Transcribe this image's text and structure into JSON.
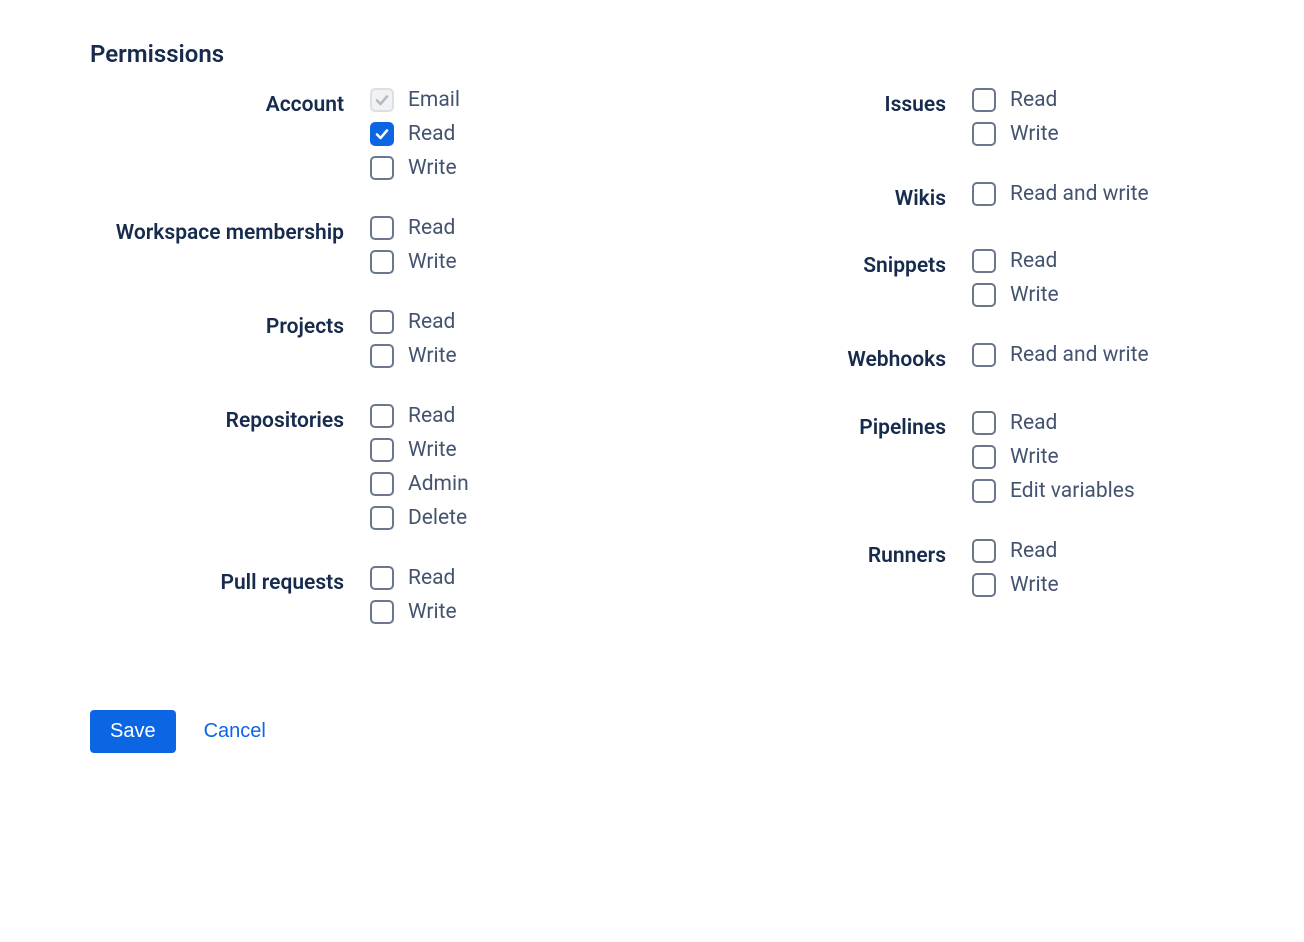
{
  "heading": "Permissions",
  "columns": [
    [
      {
        "label": "Account",
        "options": [
          {
            "label": "Email",
            "state": "disabled"
          },
          {
            "label": "Read",
            "state": "checked"
          },
          {
            "label": "Write",
            "state": "unchecked"
          }
        ]
      },
      {
        "label": "Workspace membership",
        "options": [
          {
            "label": "Read",
            "state": "unchecked"
          },
          {
            "label": "Write",
            "state": "unchecked"
          }
        ]
      },
      {
        "label": "Projects",
        "options": [
          {
            "label": "Read",
            "state": "unchecked"
          },
          {
            "label": "Write",
            "state": "unchecked"
          }
        ]
      },
      {
        "label": "Repositories",
        "options": [
          {
            "label": "Read",
            "state": "unchecked"
          },
          {
            "label": "Write",
            "state": "unchecked"
          },
          {
            "label": "Admin",
            "state": "unchecked"
          },
          {
            "label": "Delete",
            "state": "unchecked"
          }
        ]
      },
      {
        "label": "Pull requests",
        "options": [
          {
            "label": "Read",
            "state": "unchecked"
          },
          {
            "label": "Write",
            "state": "unchecked"
          }
        ]
      }
    ],
    [
      {
        "label": "Issues",
        "options": [
          {
            "label": "Read",
            "state": "unchecked"
          },
          {
            "label": "Write",
            "state": "unchecked"
          }
        ]
      },
      {
        "label": "Wikis",
        "options": [
          {
            "label": "Read and write",
            "state": "unchecked"
          }
        ]
      },
      {
        "label": "Snippets",
        "options": [
          {
            "label": "Read",
            "state": "unchecked"
          },
          {
            "label": "Write",
            "state": "unchecked"
          }
        ]
      },
      {
        "label": "Webhooks",
        "options": [
          {
            "label": "Read and write",
            "state": "unchecked"
          }
        ]
      },
      {
        "label": "Pipelines",
        "options": [
          {
            "label": "Read",
            "state": "unchecked"
          },
          {
            "label": "Write",
            "state": "unchecked"
          },
          {
            "label": "Edit variables",
            "state": "unchecked"
          }
        ]
      },
      {
        "label": "Runners",
        "options": [
          {
            "label": "Read",
            "state": "unchecked"
          },
          {
            "label": "Write",
            "state": "unchecked"
          }
        ]
      }
    ]
  ],
  "actions": {
    "save": "Save",
    "cancel": "Cancel"
  }
}
